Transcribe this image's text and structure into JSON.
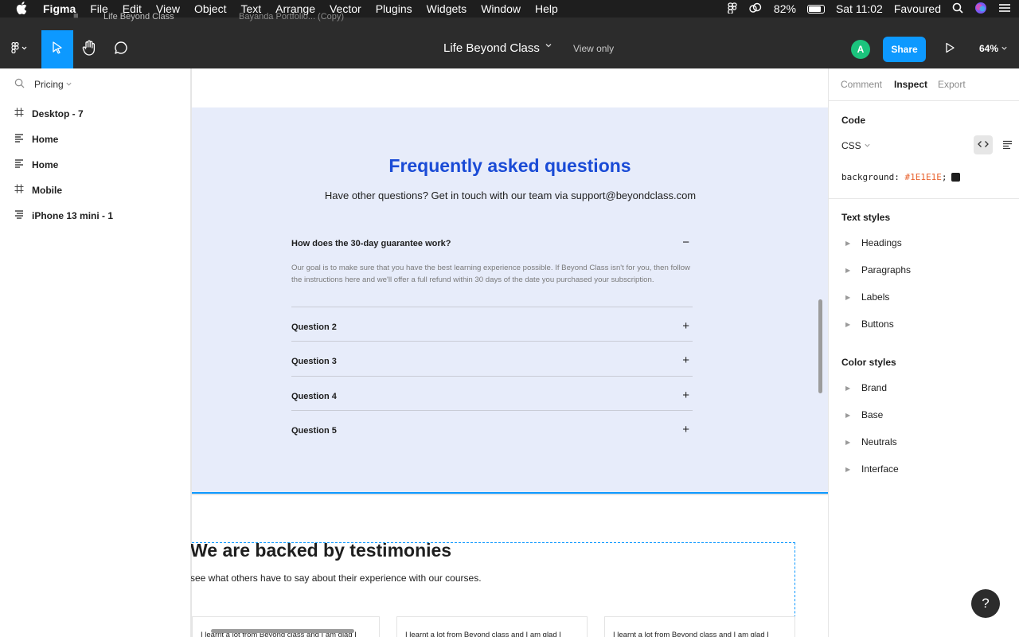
{
  "menubar": {
    "apple": "",
    "items": [
      "Figma",
      "File",
      "Edit",
      "View",
      "Object",
      "Text",
      "Arrange",
      "Vector",
      "Plugins",
      "Widgets",
      "Window",
      "Help"
    ],
    "battery": "82%",
    "clock": "Sat 11:02",
    "user": "Favoured"
  },
  "tabs": [
    "Life Beyond Class",
    "Bayanda Portfolio... (Copy)"
  ],
  "toolbar": {
    "doc_title": "Life Beyond Class",
    "view_only": "View only",
    "avatar_initial": "A",
    "share_label": "Share",
    "zoom": "64%"
  },
  "left_panel": {
    "page": "Pricing",
    "layers": [
      {
        "label": "Desktop - 7",
        "icon": "frame-icon"
      },
      {
        "label": "Home",
        "icon": "text-icon"
      },
      {
        "label": "Home",
        "icon": "text-icon"
      },
      {
        "label": "Mobile",
        "icon": "frame-icon"
      },
      {
        "label": "iPhone 13 mini - 1",
        "icon": "component-icon"
      }
    ]
  },
  "canvas": {
    "faq": {
      "title": "Frequently asked questions",
      "subtitle": "Have other questions? Get in touch with our team via support@beyondclass.com",
      "items": [
        {
          "question": "How does the 30-day guarantee work?",
          "toggle": "−",
          "answer": "Our goal is to make sure that you have the best learning experience possible. If Beyond Class isn't for you, then follow the instructions here and we'll offer a full refund within 30 days of the date you purchased your subscription."
        },
        {
          "question": "Question 2",
          "toggle": "+"
        },
        {
          "question": "Question 3",
          "toggle": "+"
        },
        {
          "question": "Question 4",
          "toggle": "+"
        },
        {
          "question": "Question 5",
          "toggle": "+"
        }
      ]
    },
    "testimonials": {
      "title": "We are backed by testimonies",
      "subtitle": "see what others have to say about their experience with our courses.",
      "cards": [
        "I learnt a lot from Beyond class and I am glad I",
        "I learnt a lot from Beyond class and I am glad I",
        "I learnt a lot from Beyond class and I am glad I"
      ]
    }
  },
  "right_panel": {
    "tabs": [
      "Comment",
      "Inspect",
      "Export"
    ],
    "active_tab": "Inspect",
    "code_title": "Code",
    "language": "CSS",
    "code_property": "background:",
    "code_value": "#1E1E1E",
    "code_suffix": ";",
    "text_styles_title": "Text styles",
    "text_styles": [
      "Headings",
      "Paragraphs",
      "Labels",
      "Buttons"
    ],
    "color_styles_title": "Color styles",
    "color_styles": [
      "Brand",
      "Base",
      "Neutrals",
      "Interface"
    ]
  },
  "help": "?",
  "colors": {
    "accent": "#0d99ff",
    "faq_title": "#1a4bd6",
    "faq_bg": "#e7ecfa",
    "code_value": "#e9622e",
    "swatch": "#1E1E1E"
  }
}
